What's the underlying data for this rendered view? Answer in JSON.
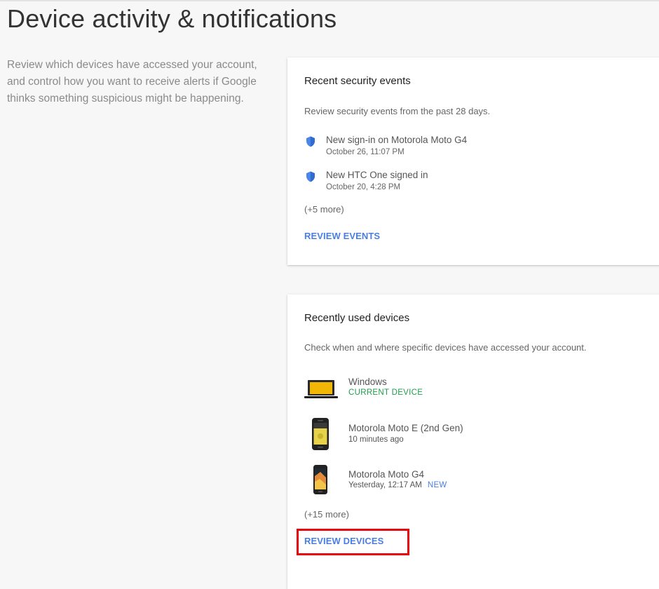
{
  "page": {
    "title": "Device activity & notifications",
    "intro": "Review which devices have accessed your account, and control how you want to receive alerts if Google thinks something suspicious might be happening."
  },
  "security_card": {
    "title": "Recent security events",
    "description": "Review security events from the past 28 days.",
    "events": [
      {
        "title": "New sign-in on Motorola Moto G4",
        "time": "October 26, 11:07 PM",
        "icon": "shield-icon"
      },
      {
        "title": "New HTC One signed in",
        "time": "October 20, 4:28 PM",
        "icon": "shield-icon"
      }
    ],
    "more": "(+5 more)",
    "action_label": "REVIEW EVENTS"
  },
  "devices_card": {
    "title": "Recently used devices",
    "description": "Check when and where specific devices have accessed your account.",
    "devices": [
      {
        "name": "Windows",
        "status": "CURRENT DEVICE",
        "icon": "laptop-icon"
      },
      {
        "name": "Motorola Moto E (2nd Gen)",
        "last_used": "10 minutes ago",
        "icon": "phone-icon"
      },
      {
        "name": "Motorola Moto G4",
        "last_used": "Yesterday, 12:17 AM",
        "badge": "NEW",
        "icon": "phone-icon"
      }
    ],
    "more": "(+15 more)",
    "action_label": "REVIEW DEVICES"
  },
  "colors": {
    "link": "#4a7ee3",
    "current_device": "#1e9e4a",
    "shield": "#4a86e8",
    "highlight": "#e8000b"
  }
}
